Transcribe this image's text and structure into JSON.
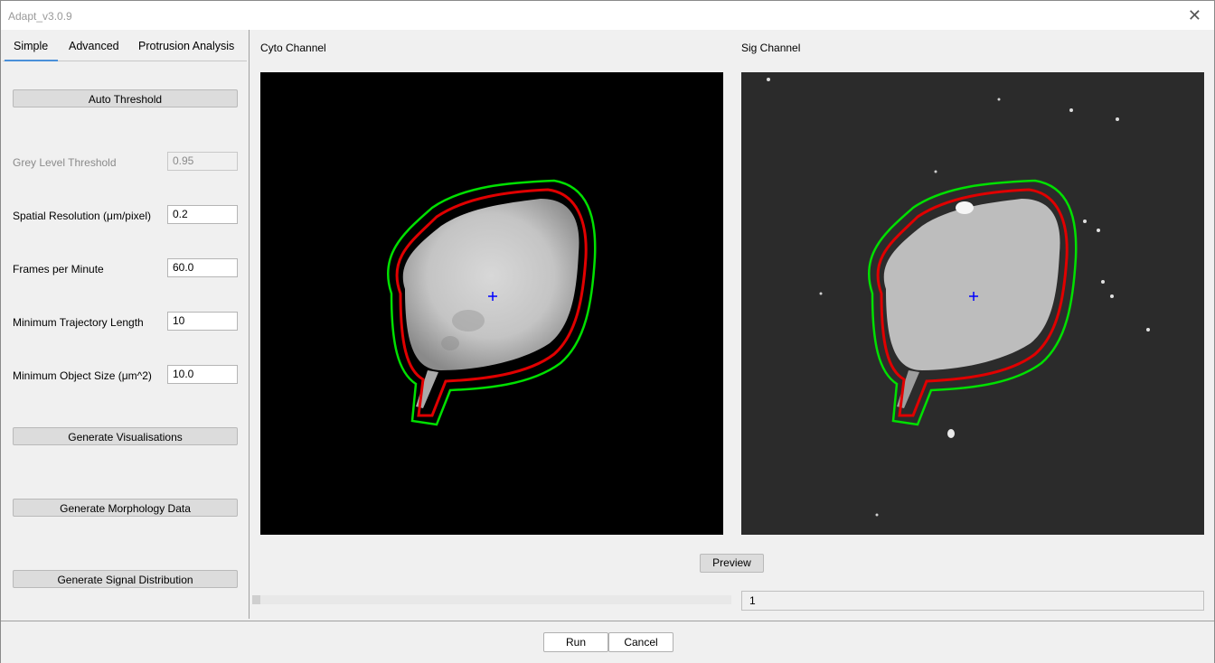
{
  "window": {
    "title": "Adapt_v3.0.9"
  },
  "tabs": [
    {
      "label": "Simple",
      "selected": true
    },
    {
      "label": "Advanced"
    },
    {
      "label": "Protrusion Analysis"
    }
  ],
  "simple": {
    "auto_threshold_label": "Auto Threshold",
    "grey_level": {
      "label": "Grey Level Threshold",
      "value": "0.95"
    },
    "spatial_resolution": {
      "label": "Spatial Resolution (μm/pixel)",
      "value": "0.2"
    },
    "frames_per_minute": {
      "label": "Frames per Minute",
      "value": "60.0"
    },
    "min_trajectory": {
      "label": "Minimum Trajectory Length",
      "value": "10"
    },
    "min_object_size": {
      "label": "Minimum Object Size (μm^2)",
      "value": "10.0"
    },
    "gen_vis_label": "Generate Visualisations",
    "gen_morph_label": "Generate Morphology Data",
    "gen_signal_label": "Generate Signal Distribution"
  },
  "channels": {
    "cyto_label": "Cyto Channel",
    "sig_label": "Sig Channel"
  },
  "preview_label": "Preview",
  "frame": {
    "value": "1",
    "slider_position": 0
  },
  "footer": {
    "run_label": "Run",
    "cancel_label": "Cancel"
  },
  "colors": {
    "contour_outer": "#00e000",
    "contour_inner": "#e00000",
    "centroid": "#0000ff",
    "accent": "#4a90d9"
  },
  "icons": {
    "close": "close-icon"
  }
}
